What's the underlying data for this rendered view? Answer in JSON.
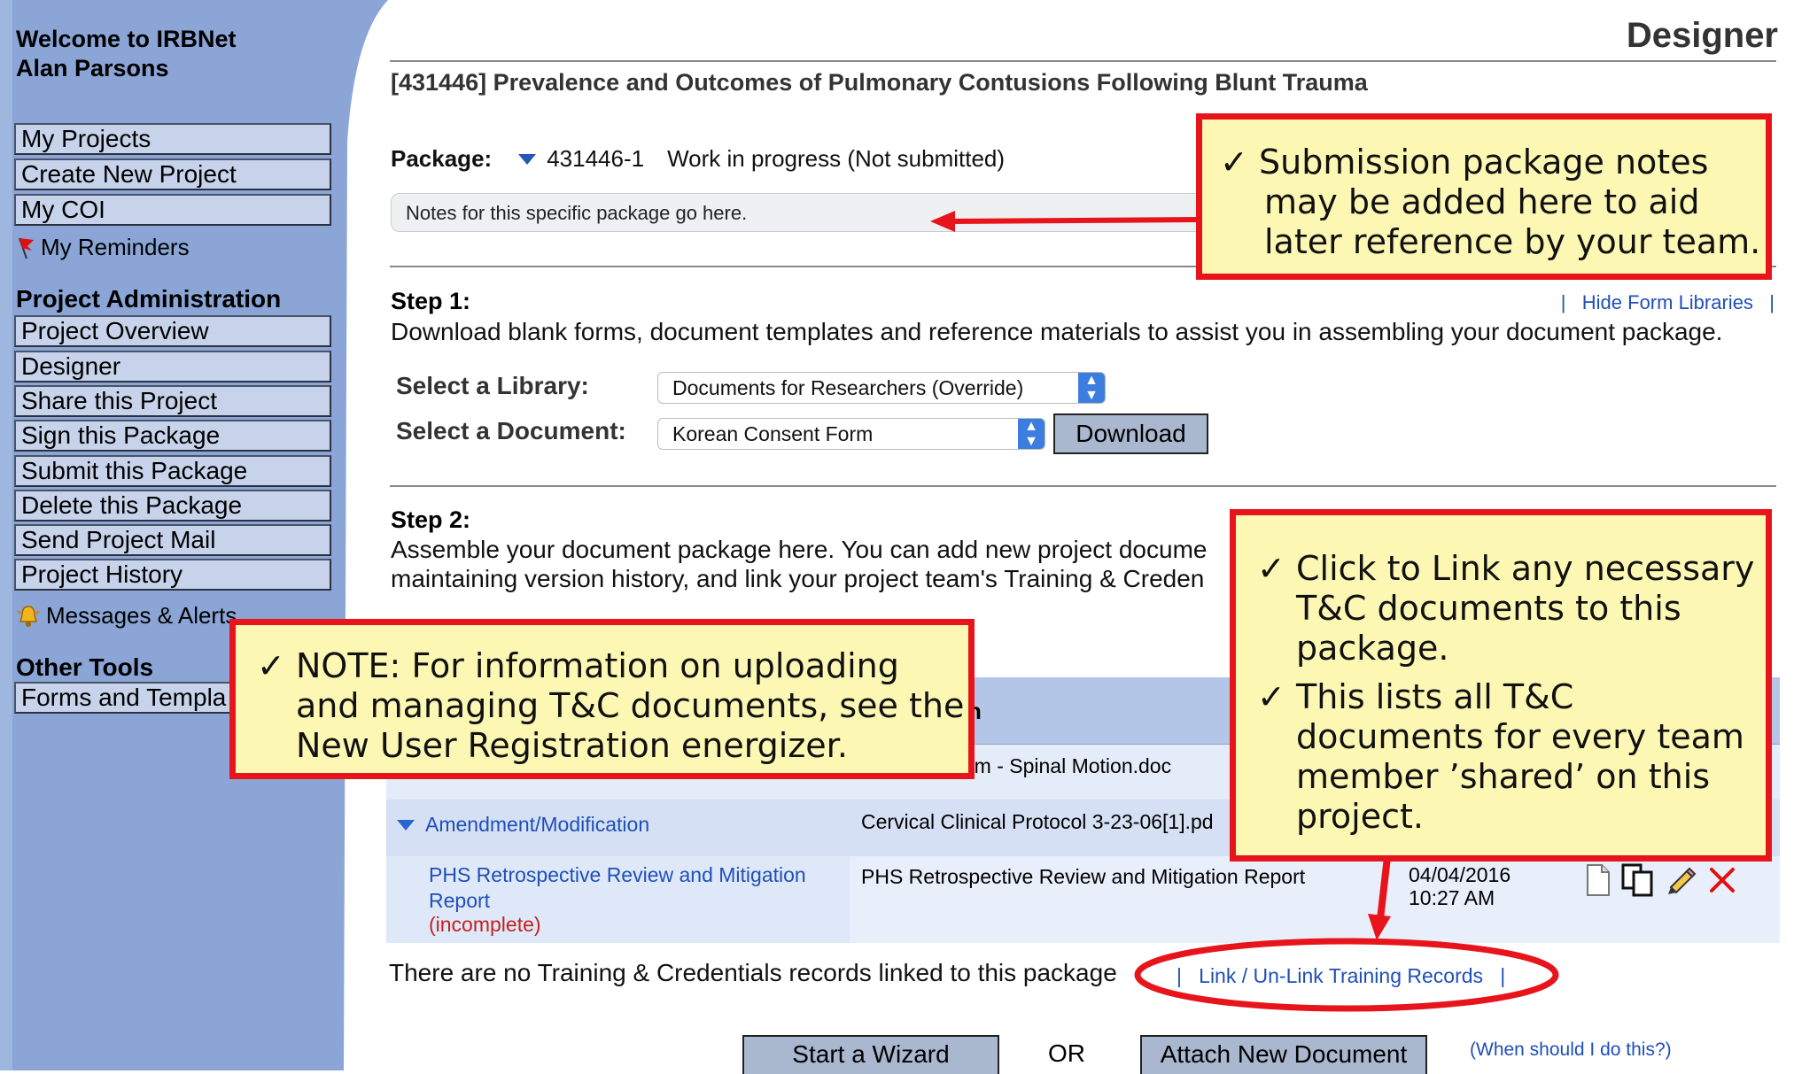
{
  "sidebar": {
    "welcome_line1": "Welcome to IRBNet",
    "welcome_line2": "Alan Parsons",
    "main_items": [
      "My Projects",
      "Create New Project",
      "My COI"
    ],
    "reminders": "My Reminders",
    "admin_heading": "Project Administration",
    "admin_items": [
      "Project Overview",
      "Designer",
      "Share this Project",
      "Sign this Package",
      "Submit this Package",
      "Delete this Package",
      "Send Project Mail",
      "Project History"
    ],
    "messages": "Messages & Alerts",
    "tools_heading": "Other Tools",
    "tools_items": [
      "Forms and Templa"
    ]
  },
  "header": {
    "page_title": "Designer",
    "project_title": "[431446] Prevalence and Outcomes of Pulmonary Contusions Following Blunt Trauma"
  },
  "package": {
    "label": "Package:",
    "number": "431446-1",
    "status": "Work in progress (Not submitted)",
    "notes": "Notes for this specific package go here."
  },
  "step1": {
    "heading": "Step 1:",
    "text": "Download blank forms, document templates and reference materials to assist you in assembling your document package.",
    "hide_link": "Hide Form Libraries",
    "library_label": "Select a Library:",
    "library_value": "Documents for Researchers (Override)",
    "document_label": "Select a Document:",
    "document_value": "Korean Consent Form",
    "download_button": "Download"
  },
  "step2": {
    "heading": "Step 2:",
    "line1": "Assemble your document package here. You can add new project docume",
    "line2": "maintaining version history, and link your project team's Training & Creden"
  },
  "table": {
    "header_partial": "n",
    "row0_doc": "rm - Spinal Motion.doc",
    "row1_type": "Amendment/Modification",
    "row1_doc": "Cervical Clinical Protocol 3-23-06[1].pd",
    "row2_type_line1": "PHS Retrospective Review and Mitigation",
    "row2_type_line2": "Report",
    "row2_incomplete": "(incomplete)",
    "row2_doc": "PHS Retrospective Review and Mitigation Report",
    "row2_date": "04/04/2016",
    "row2_time": "10:27 AM"
  },
  "training": {
    "text": "There are no Training & Credentials records linked to this package",
    "link": "Link / Un-Link Training Records"
  },
  "bottom": {
    "wizard_button": "Start a Wizard",
    "or": "OR",
    "attach_button": "Attach New Document",
    "when_link": "(When should I do this?)"
  },
  "callouts": {
    "notes": [
      "Submission package notes",
      "may be added here to aid",
      "later reference by your team."
    ],
    "note_tc": [
      "NOTE: For information on uploading",
      "and managing T&C documents, see the",
      "New User Registration energizer."
    ],
    "link_items": [
      [
        "Click to Link any necessary",
        "T&C documents to this",
        "package."
      ],
      [
        "This lists all T&C",
        "documents for every team",
        "member ’shared’ on this",
        "project."
      ]
    ]
  },
  "colors": {
    "sidebar_blue": "#8aa5d6",
    "callout_border": "#e8141b",
    "callout_fill": "#fdf7b4",
    "link": "#1f4fb8"
  }
}
